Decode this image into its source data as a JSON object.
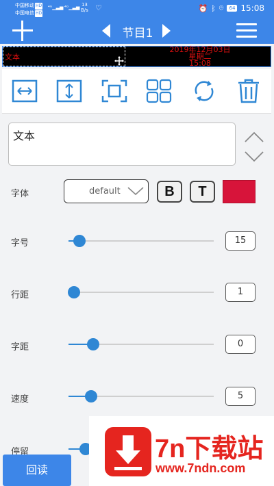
{
  "status": {
    "carrier1": "中国移动",
    "carrier2": "中国电信",
    "hd": "HD",
    "net_speed": "13",
    "net_unit": "B/s",
    "battery": "64",
    "time": "15:08"
  },
  "toolbar": {
    "title": "节目1"
  },
  "preview": {
    "selected_text": "文本",
    "date_line": "2019年12月03日",
    "weekday_line": "星期二",
    "time_line": "15:08"
  },
  "tools": {
    "icons": [
      "stretch-horizontal-icon",
      "stretch-vertical-icon",
      "fullscreen-icon",
      "grid-icon",
      "rotate-icon",
      "delete-icon"
    ]
  },
  "editor": {
    "text_value": "文本"
  },
  "font": {
    "label": "字体",
    "select_value": "default",
    "bold_label": "B",
    "style_label": "T",
    "color": "#d7143a"
  },
  "sliders": [
    {
      "label": "字号",
      "value": "15",
      "level": 0.04
    },
    {
      "label": "行距",
      "value": "1",
      "level": 0.0
    },
    {
      "label": "字距",
      "value": "0",
      "level": 0.13
    },
    {
      "label": "速度",
      "value": "5",
      "level": 0.12
    },
    {
      "label": "停留",
      "value": "",
      "level": 0.08
    }
  ],
  "footer": {
    "read_button": "回读"
  },
  "watermark": {
    "brand": "7n下载站",
    "site": "www.7ndn.com"
  },
  "colors": {
    "accent": "#3d86e8",
    "slider": "#2f87d4",
    "led_text": "#e01010"
  }
}
